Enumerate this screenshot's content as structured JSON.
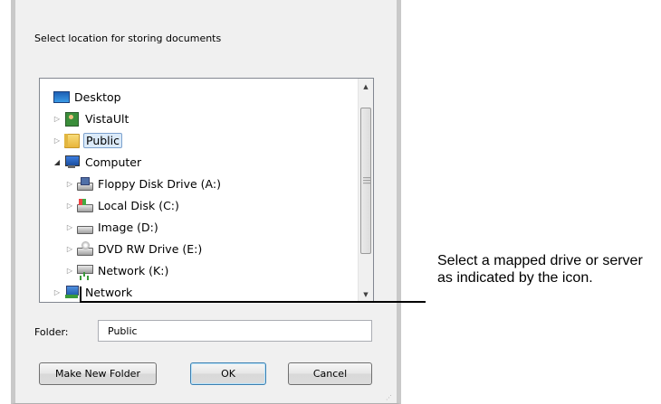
{
  "dialog": {
    "prompt": "Select location for storing documents",
    "folder_label": "Folder:",
    "folder_value": "Public",
    "buttons": {
      "make_new_folder": "Make New Folder",
      "ok": "OK",
      "cancel": "Cancel"
    },
    "tree": [
      {
        "label": "Desktop",
        "icon": "desktop-icon",
        "expander": "none",
        "selected": false
      },
      {
        "label": "VistaUlt",
        "icon": "user-folder-icon",
        "expander": "collapsed",
        "selected": false
      },
      {
        "label": "Public",
        "icon": "folder-icon",
        "expander": "collapsed",
        "selected": true
      },
      {
        "label": "Computer",
        "icon": "computer-icon",
        "expander": "expanded",
        "selected": false
      },
      {
        "label": "Floppy Disk Drive (A:)",
        "icon": "floppy-drive-icon",
        "expander": "collapsed",
        "selected": false
      },
      {
        "label": "Local Disk (C:)",
        "icon": "local-disk-icon",
        "expander": "collapsed",
        "selected": false
      },
      {
        "label": "Image (D:)",
        "icon": "drive-icon",
        "expander": "collapsed",
        "selected": false
      },
      {
        "label": "DVD RW Drive (E:)",
        "icon": "dvd-drive-icon",
        "expander": "collapsed",
        "selected": false
      },
      {
        "label": "Network (K:)",
        "icon": "network-drive-icon",
        "expander": "collapsed",
        "selected": false
      },
      {
        "label": "Network",
        "icon": "network-icon",
        "expander": "collapsed",
        "selected": false
      }
    ]
  },
  "callout": {
    "text": "Select a mapped drive or server as indicated by the icon."
  }
}
